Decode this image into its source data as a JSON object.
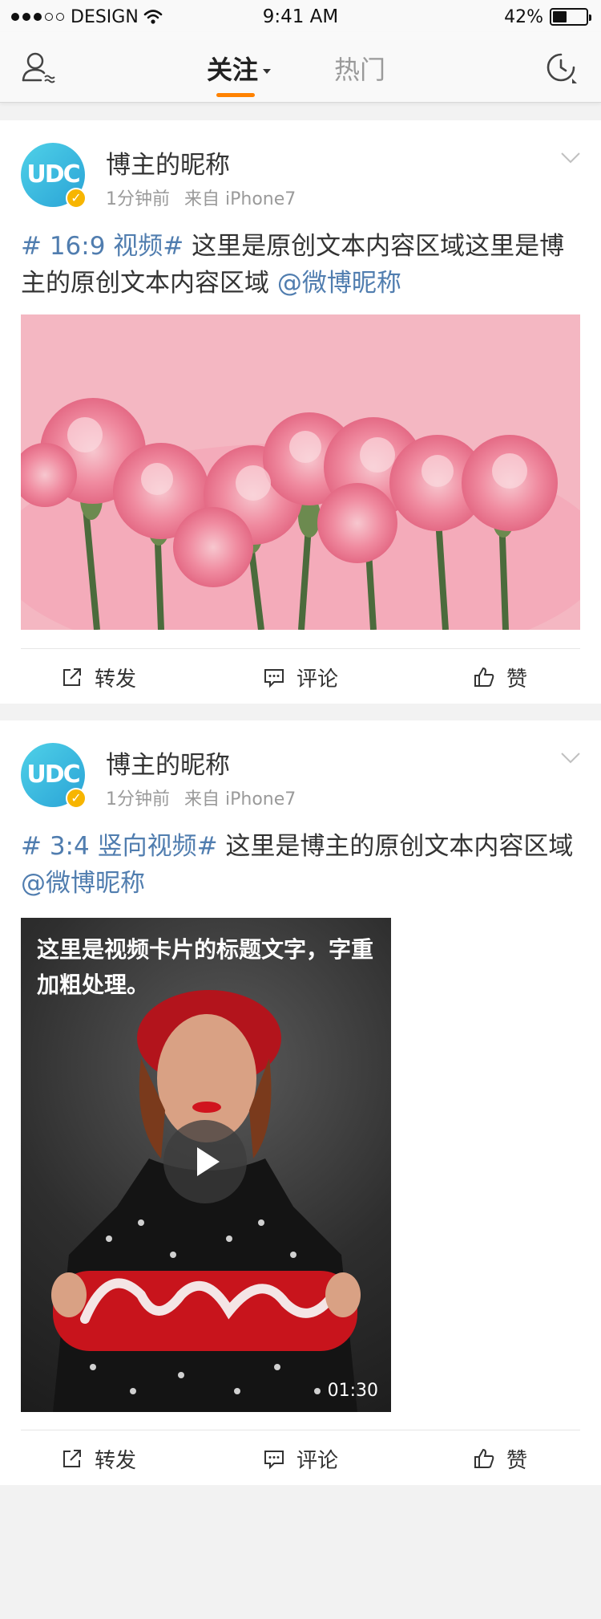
{
  "status_bar": {
    "carrier": "DESIGN",
    "time": "9:41 AM",
    "battery": "42%",
    "battery_level": 0.42
  },
  "nav": {
    "tab_follow": "关注",
    "tab_hot": "热门"
  },
  "posts": [
    {
      "author": "博主的昵称",
      "avatar_text": "UDC",
      "time": "1分钟前",
      "source": "来自 iPhone7",
      "topic": "# 16:9 视频#",
      "text": " 这里是原创文本内容区域这里是博主的原创文本内容区域 ",
      "mention": "@微博昵称",
      "media": "flower-photo"
    },
    {
      "author": "博主的昵称",
      "avatar_text": "UDC",
      "time": "1分钟前",
      "source": "来自 iPhone7",
      "topic": "# 3:4 竖向视频#",
      "text": " 这里是博主的原创文本内容区域 ",
      "mention": "@微博昵称",
      "video_title": "这里是视频卡片的标题文字，字重加粗处理。",
      "video_duration": "01:30",
      "media": "love-sign-photo"
    }
  ],
  "actions": {
    "repost": "转发",
    "comment": "评论",
    "like": "赞"
  },
  "colors": {
    "accent": "#ff8200",
    "link": "#507daf",
    "badge": "#f7b500"
  }
}
